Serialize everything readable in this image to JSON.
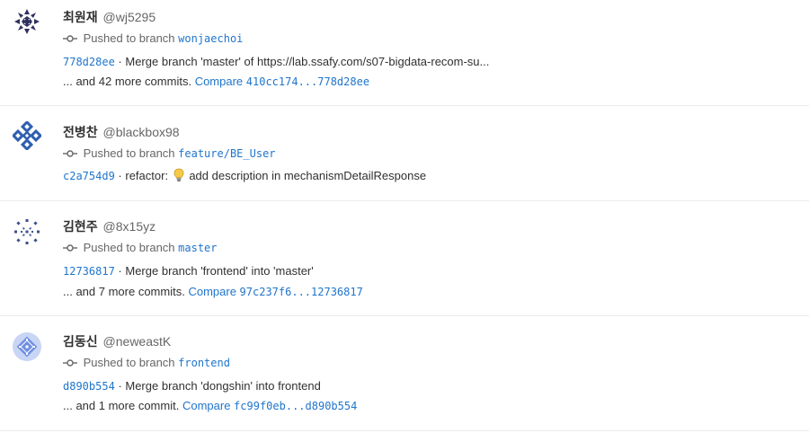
{
  "events": [
    {
      "author_name": "최원재",
      "author_handle": "@wj5295",
      "action_text": "Pushed to branch",
      "branch": "wonjaechoi",
      "commit_sha": "778d28ee",
      "commit_message": "Merge branch 'master' of https://lab.ssafy.com/s07-bigdata-recom-su...",
      "more_text": "... and 42 more commits.",
      "compare_label": "Compare",
      "compare_range": "410cc174...778d28ee",
      "avatar_color": "#303060"
    },
    {
      "author_name": "전병찬",
      "author_handle": "@blackbox98",
      "action_text": "Pushed to branch",
      "branch": "feature/BE_User",
      "commit_sha": "c2a754d9",
      "commit_prefix": "refactor:",
      "commit_emoji": "lightbulb-icon",
      "commit_message": "add description in mechanismDetailResponse",
      "avatar_color": "#2e5fb0"
    },
    {
      "author_name": "김현주",
      "author_handle": "@8x15yz",
      "action_text": "Pushed to branch",
      "branch": "master",
      "commit_sha": "12736817",
      "commit_message": "Merge branch 'frontend' into 'master'",
      "more_text": "... and 7 more commits.",
      "compare_label": "Compare",
      "compare_range": "97c237f6...12736817",
      "avatar_color": "#3b4f8a"
    },
    {
      "author_name": "김동신",
      "author_handle": "@neweastK",
      "action_text": "Pushed to branch",
      "branch": "frontend",
      "commit_sha": "d890b554",
      "commit_message": "Merge branch 'dongshin' into frontend",
      "more_text": "... and 1 more commit.",
      "compare_label": "Compare",
      "compare_range": "fc99f0eb...d890b554",
      "avatar_color": "#6f8fe0"
    }
  ],
  "colors": {
    "link": "#1f75cb",
    "text": "#303030",
    "muted": "#666666",
    "divider": "#ececec"
  }
}
